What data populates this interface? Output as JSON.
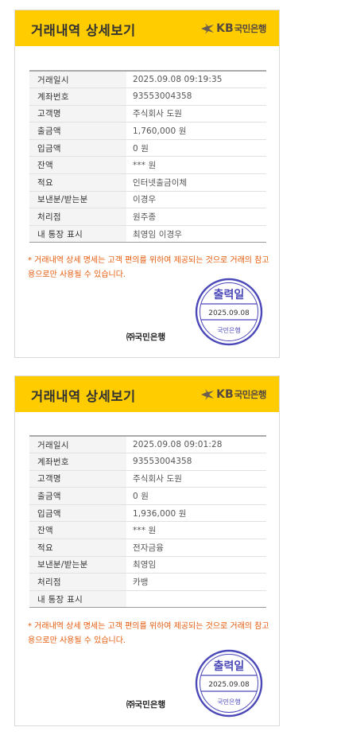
{
  "cards": [
    {
      "title": "거래내역 상세보기",
      "logo": {
        "symbol": "kb-star-icon",
        "kb": "KB",
        "bank": "국민은행"
      },
      "rows": [
        {
          "label": "거래일시",
          "value": "2025.09.08 09:19:35"
        },
        {
          "label": "계좌번호",
          "value": "93553004358"
        },
        {
          "label": "고객명",
          "value": "주식회사 도원"
        },
        {
          "label": "출금액",
          "value": "1,760,000 원"
        },
        {
          "label": "입금액",
          "value": "0 원"
        },
        {
          "label": "잔액",
          "value": "*** 원"
        },
        {
          "label": "적요",
          "value": "인터넷출금이체"
        },
        {
          "label": "보낸분/받는분",
          "value": "이경우"
        },
        {
          "label": "처리점",
          "value": "원주종"
        },
        {
          "label": "내 통장 표시",
          "value": "최영임 이경우"
        }
      ],
      "notice": "* 거래내역 상세 명세는 고객 편의를 위하여 제공되는 것으로 거래의 참고용으로만 사용될 수 있습니다.",
      "stamp": {
        "top_text": "출력일",
        "date": "2025.09.08",
        "bottom_text": "국민은행"
      },
      "issuer": "㈜국민은행"
    },
    {
      "title": "거래내역 상세보기",
      "logo": {
        "symbol": "kb-star-icon",
        "kb": "KB",
        "bank": "국민은행"
      },
      "rows": [
        {
          "label": "거래일시",
          "value": "2025.09.08 09:01:28"
        },
        {
          "label": "계좌번호",
          "value": "93553004358"
        },
        {
          "label": "고객명",
          "value": "주식회사 도원"
        },
        {
          "label": "출금액",
          "value": "0 원"
        },
        {
          "label": "입금액",
          "value": "1,936,000 원"
        },
        {
          "label": "잔액",
          "value": "*** 원"
        },
        {
          "label": "적요",
          "value": "전자금융"
        },
        {
          "label": "보낸분/받는분",
          "value": "최영임"
        },
        {
          "label": "처리점",
          "value": "카뱅"
        },
        {
          "label": "내 통장 표시",
          "value": ""
        }
      ],
      "notice": "* 거래내역 상세 명세는 고객 편의를 위하여 제공되는 것으로 거래의 참고용으로만 사용될 수 있습니다.",
      "stamp": {
        "top_text": "출력일",
        "date": "2025.09.08",
        "bottom_text": "국민은행"
      },
      "issuer": "㈜국민은행"
    }
  ],
  "colors": {
    "header": "#ffcc00",
    "notice": "#e55a0c",
    "stamp": "#4b48b8"
  }
}
